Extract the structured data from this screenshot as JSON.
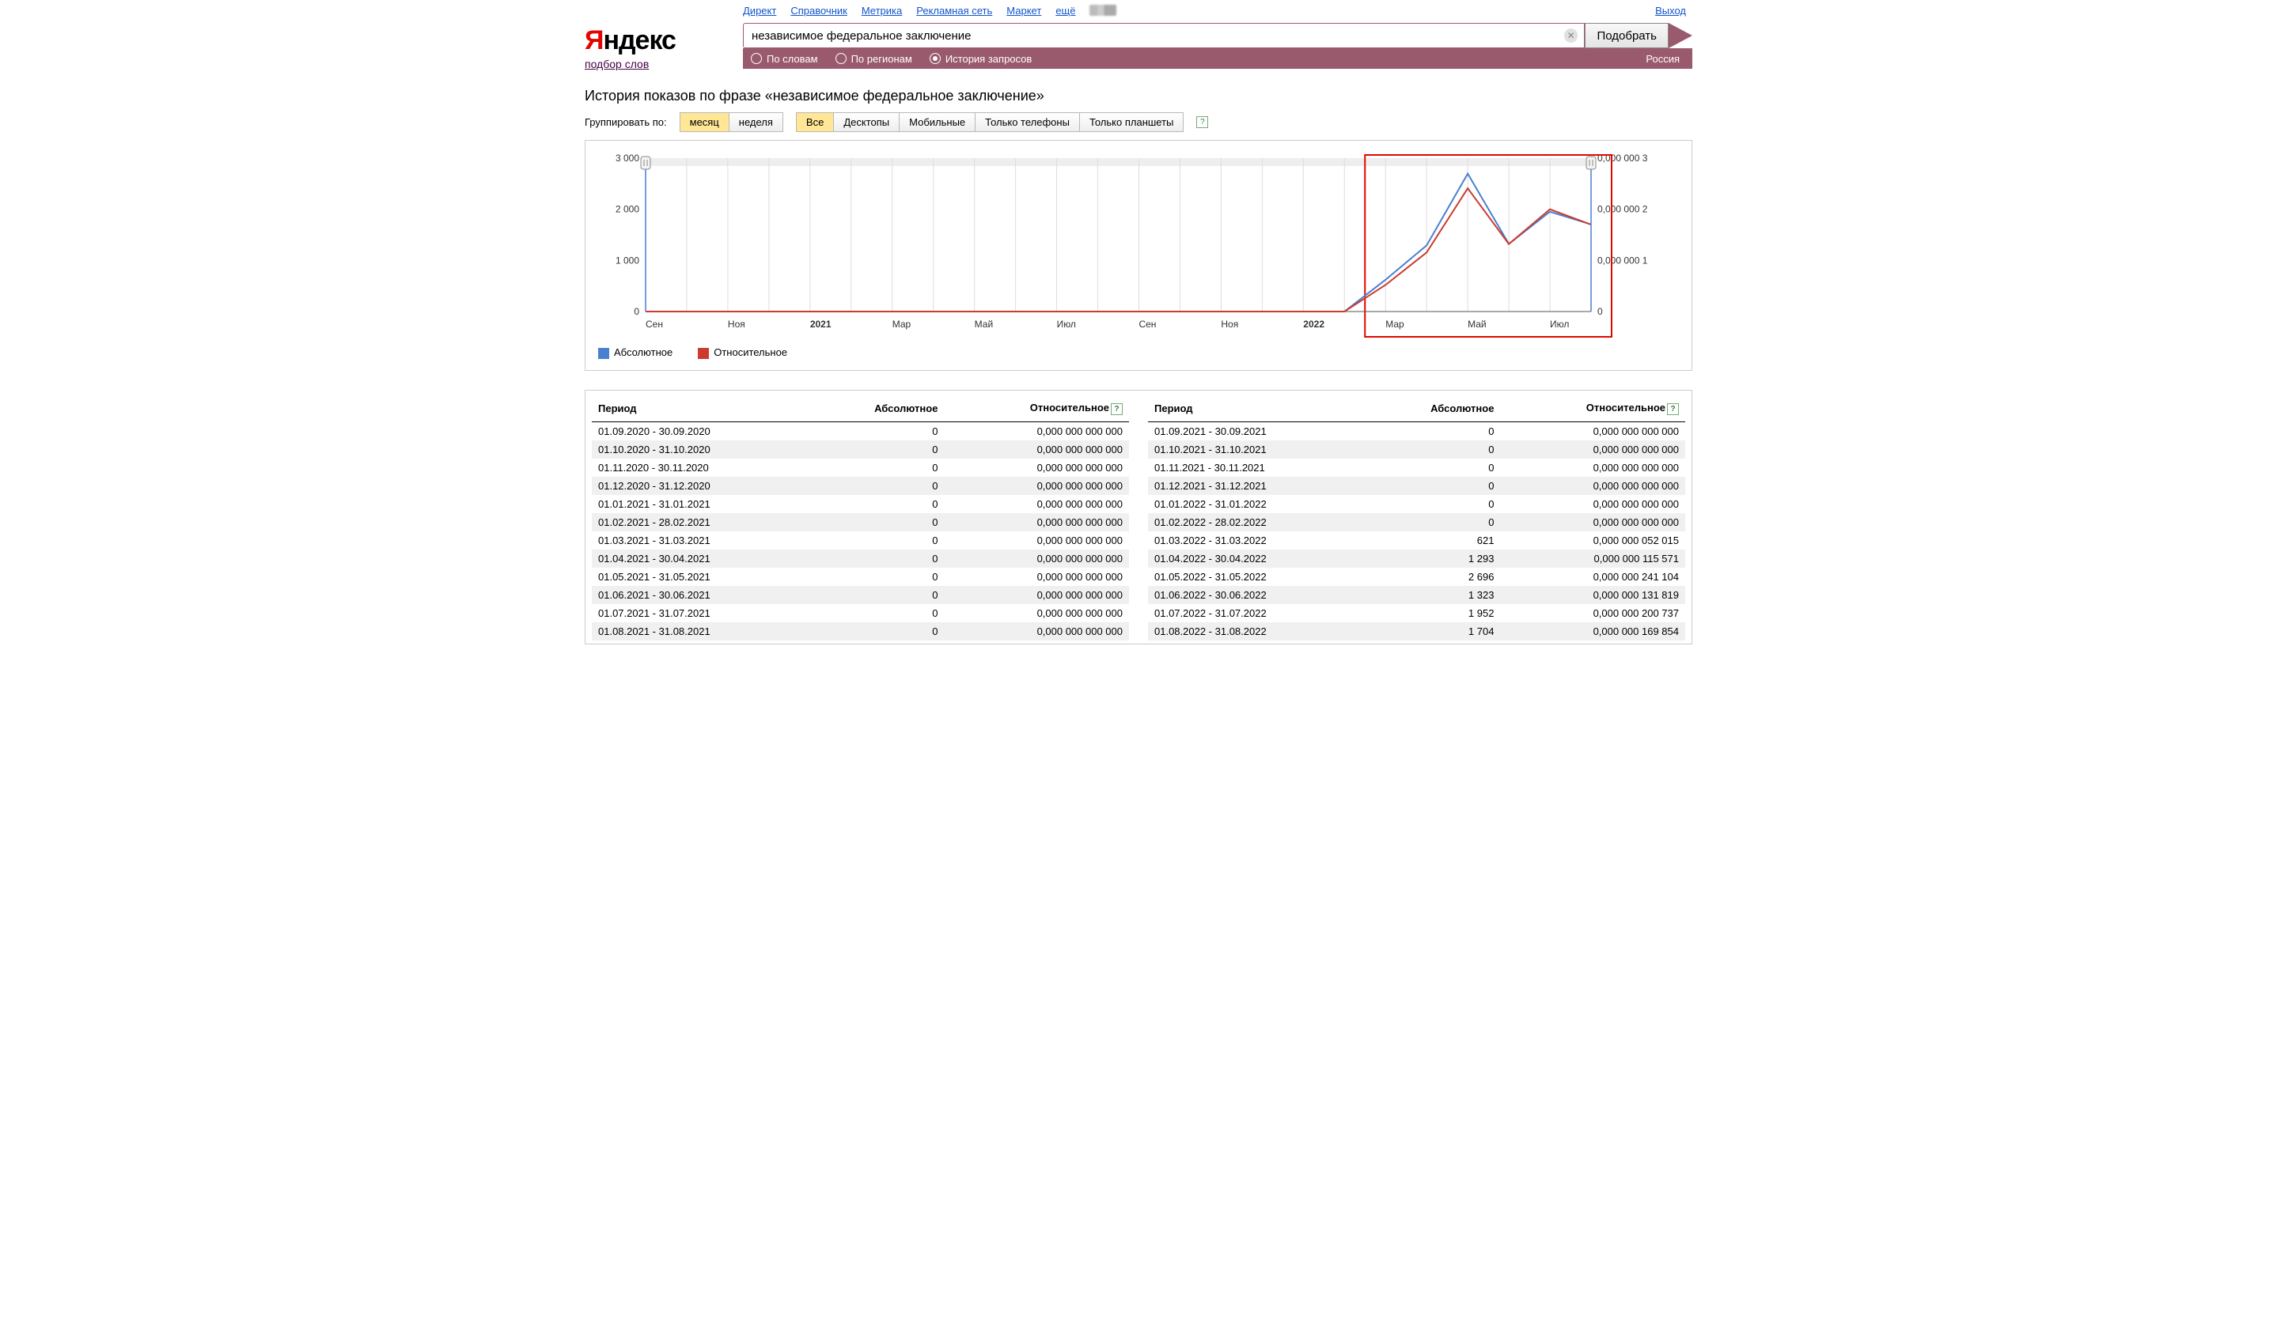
{
  "header": {
    "nav": [
      "Директ",
      "Справочник",
      "Метрика",
      "Рекламная сеть",
      "Маркет",
      "ещё"
    ],
    "exit": "Выход",
    "logo_pre": "Я",
    "logo_rest": "ндекс",
    "sublogo": "подбор слов"
  },
  "search": {
    "value": "независимое федеральное заключение",
    "submit": "Подобрать"
  },
  "tabs": {
    "by_words": "По словам",
    "by_regions": "По регионам",
    "history": "История запросов",
    "region": "Россия",
    "selected": "history"
  },
  "title": "История показов по фразе «независимое федеральное заключение»",
  "group": {
    "label": "Группировать по:",
    "month": "месяц",
    "week": "неделя",
    "all": "Все",
    "desktop": "Десктопы",
    "mobile": "Мобильные",
    "phones": "Только телефоны",
    "tablets": "Только планшеты"
  },
  "legend": {
    "abs": "Абсолютное",
    "rel": "Относительное"
  },
  "table_headers": {
    "period": "Период",
    "abs": "Абсолютное",
    "rel": "Относительное"
  },
  "table_left": [
    {
      "p": "01.09.2020 - 30.09.2020",
      "a": "0",
      "r": "0,000 000 000 000"
    },
    {
      "p": "01.10.2020 - 31.10.2020",
      "a": "0",
      "r": "0,000 000 000 000"
    },
    {
      "p": "01.11.2020 - 30.11.2020",
      "a": "0",
      "r": "0,000 000 000 000"
    },
    {
      "p": "01.12.2020 - 31.12.2020",
      "a": "0",
      "r": "0,000 000 000 000"
    },
    {
      "p": "01.01.2021 - 31.01.2021",
      "a": "0",
      "r": "0,000 000 000 000"
    },
    {
      "p": "01.02.2021 - 28.02.2021",
      "a": "0",
      "r": "0,000 000 000 000"
    },
    {
      "p": "01.03.2021 - 31.03.2021",
      "a": "0",
      "r": "0,000 000 000 000"
    },
    {
      "p": "01.04.2021 - 30.04.2021",
      "a": "0",
      "r": "0,000 000 000 000"
    },
    {
      "p": "01.05.2021 - 31.05.2021",
      "a": "0",
      "r": "0,000 000 000 000"
    },
    {
      "p": "01.06.2021 - 30.06.2021",
      "a": "0",
      "r": "0,000 000 000 000"
    },
    {
      "p": "01.07.2021 - 31.07.2021",
      "a": "0",
      "r": "0,000 000 000 000"
    },
    {
      "p": "01.08.2021 - 31.08.2021",
      "a": "0",
      "r": "0,000 000 000 000"
    }
  ],
  "table_right": [
    {
      "p": "01.09.2021 - 30.09.2021",
      "a": "0",
      "r": "0,000 000 000 000"
    },
    {
      "p": "01.10.2021 - 31.10.2021",
      "a": "0",
      "r": "0,000 000 000 000"
    },
    {
      "p": "01.11.2021 - 30.11.2021",
      "a": "0",
      "r": "0,000 000 000 000"
    },
    {
      "p": "01.12.2021 - 31.12.2021",
      "a": "0",
      "r": "0,000 000 000 000"
    },
    {
      "p": "01.01.2022 - 31.01.2022",
      "a": "0",
      "r": "0,000 000 000 000"
    },
    {
      "p": "01.02.2022 - 28.02.2022",
      "a": "0",
      "r": "0,000 000 000 000"
    },
    {
      "p": "01.03.2022 - 31.03.2022",
      "a": "621",
      "r": "0,000 000 052 015"
    },
    {
      "p": "01.04.2022 - 30.04.2022",
      "a": "1 293",
      "r": "0,000 000 115 571"
    },
    {
      "p": "01.05.2022 - 31.05.2022",
      "a": "2 696",
      "r": "0,000 000 241 104"
    },
    {
      "p": "01.06.2022 - 30.06.2022",
      "a": "1 323",
      "r": "0,000 000 131 819"
    },
    {
      "p": "01.07.2022 - 31.07.2022",
      "a": "1 952",
      "r": "0,000 000 200 737"
    },
    {
      "p": "01.08.2022 - 31.08.2022",
      "a": "1 704",
      "r": "0,000 000 169 854"
    }
  ],
  "chart_data": {
    "type": "line",
    "x_labels": [
      "Сен",
      "",
      "Ноя",
      "",
      "2021",
      "",
      "Мар",
      "",
      "Май",
      "",
      "Июл",
      "",
      "Сен",
      "",
      "Ноя",
      "",
      "2022",
      "",
      "Мар",
      "",
      "Май",
      "",
      "Июл",
      ""
    ],
    "y_left": {
      "label": "",
      "ticks": [
        0,
        1000,
        2000,
        3000
      ],
      "tick_labels": [
        "0",
        "1 000",
        "2 000",
        "3 000"
      ]
    },
    "y_right": {
      "label": "",
      "ticks": [
        0,
        1,
        2,
        3
      ],
      "tick_labels": [
        "0",
        "0,000 000 1",
        "0,000 000 2",
        "0,000 000 3"
      ]
    },
    "series": [
      {
        "name": "Абсолютное",
        "color": "#4a7fd1",
        "values": [
          0,
          0,
          0,
          0,
          0,
          0,
          0,
          0,
          0,
          0,
          0,
          0,
          0,
          0,
          0,
          0,
          0,
          0,
          621,
          1293,
          2696,
          1323,
          1952,
          1704
        ]
      },
      {
        "name": "Относительное",
        "color": "#cc3b2e",
        "values": [
          0,
          0,
          0,
          0,
          0,
          0,
          0,
          0,
          0,
          0,
          0,
          0,
          0,
          0,
          0,
          0,
          0,
          0,
          520,
          1155,
          2410,
          1320,
          2000,
          1700
        ]
      }
    ],
    "highlight_box": {
      "from": 17.5,
      "to": 23.5
    }
  },
  "colors": {
    "blue": "#4a7fd1",
    "red": "#cc3b2e"
  }
}
